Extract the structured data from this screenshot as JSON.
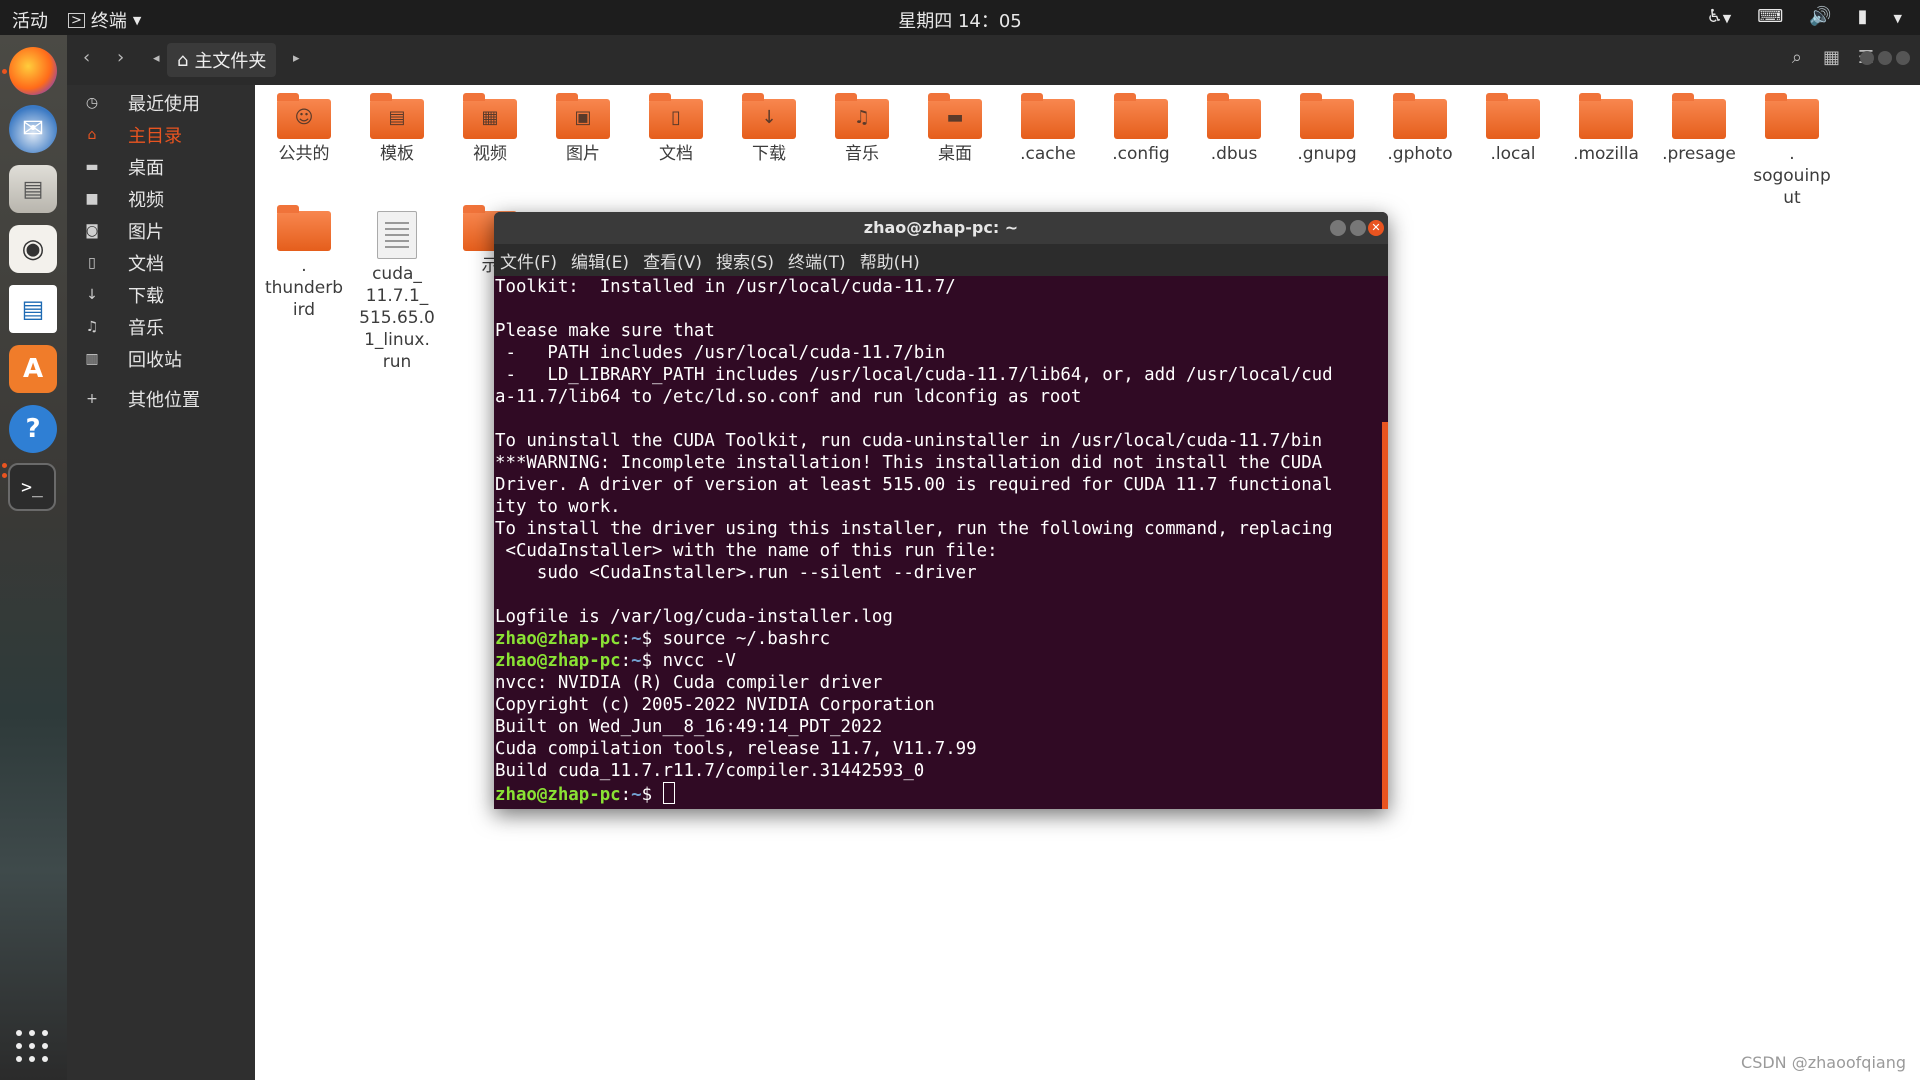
{
  "topbar": {
    "activities": "活动",
    "app_name": "终端",
    "clock": "星期四 14：05",
    "tray_icons": [
      "accessibility-icon",
      "keyboard-icon",
      "volume-icon",
      "battery-icon",
      "power-menu-icon"
    ]
  },
  "dock": {
    "items": [
      "firefox-icon",
      "thunderbird-icon",
      "files-icon",
      "rhythmbox-icon",
      "writer-icon",
      "software-icon",
      "help-icon",
      "terminal-icon"
    ],
    "show_apps": "show-applications-icon"
  },
  "file_manager": {
    "path_label": "主文件夹",
    "sidebar": [
      {
        "label": "最近使用",
        "icon": "clock-icon"
      },
      {
        "label": "主目录",
        "icon": "home-icon"
      },
      {
        "label": "桌面",
        "icon": "desktop-icon"
      },
      {
        "label": "视频",
        "icon": "video-icon"
      },
      {
        "label": "图片",
        "icon": "camera-icon"
      },
      {
        "label": "文档",
        "icon": "document-icon"
      },
      {
        "label": "下载",
        "icon": "download-icon"
      },
      {
        "label": "音乐",
        "icon": "music-icon"
      },
      {
        "label": "回收站",
        "icon": "trash-icon"
      },
      {
        "label": "其他位置",
        "icon": "plus-icon"
      }
    ],
    "files": [
      {
        "label": "公共的",
        "emblem": "user-emblem"
      },
      {
        "label": "模板",
        "emblem": "template-emblem"
      },
      {
        "label": "视频",
        "emblem": "film-emblem"
      },
      {
        "label": "图片",
        "emblem": "picture-emblem"
      },
      {
        "label": "文档",
        "emblem": "document-emblem"
      },
      {
        "label": "下载",
        "emblem": "download-emblem"
      },
      {
        "label": "音乐",
        "emblem": "music-emblem"
      },
      {
        "label": "桌面",
        "emblem": "desktop-emblem"
      },
      {
        "label": ".cache",
        "emblem": ""
      },
      {
        "label": ".config",
        "emblem": ""
      },
      {
        "label": ".dbus",
        "emblem": ""
      },
      {
        "label": ".gnupg",
        "emblem": ""
      },
      {
        "label": ".gphoto",
        "emblem": ""
      },
      {
        "label": ".local",
        "emblem": ""
      },
      {
        "label": ".mozilla",
        "emblem": ""
      },
      {
        "label": ".presage",
        "emblem": ""
      },
      {
        "label": ".\nsogouinp\nut",
        "emblem": ""
      },
      {
        "label": ".\nthunderb\nird",
        "emblem": ""
      },
      {
        "label": "cuda_\n11.7.1_\n515.65.0\n1_linux.\nrun",
        "emblem": "file"
      },
      {
        "label": "示",
        "emblem": ""
      }
    ]
  },
  "terminal": {
    "title": "zhao@zhap-pc: ~",
    "menu": [
      "文件(F)",
      "编辑(E)",
      "查看(V)",
      "搜索(S)",
      "终端(T)",
      "帮助(H)"
    ],
    "prompt_user": "zhao@zhap-pc",
    "prompt_path": "~",
    "lines": [
      "Toolkit:  Installed in /usr/local/cuda-11.7/",
      "",
      "Please make sure that",
      " -   PATH includes /usr/local/cuda-11.7/bin",
      " -   LD_LIBRARY_PATH includes /usr/local/cuda-11.7/lib64, or, add /usr/local/cud",
      "a-11.7/lib64 to /etc/ld.so.conf and run ldconfig as root",
      "",
      "To uninstall the CUDA Toolkit, run cuda-uninstaller in /usr/local/cuda-11.7/bin",
      "***WARNING: Incomplete installation! This installation did not install the CUDA",
      "Driver. A driver of version at least 515.00 is required for CUDA 11.7 functional",
      "ity to work.",
      "To install the driver using this installer, run the following command, replacing",
      " <CudaInstaller> with the name of this run file:",
      "    sudo <CudaInstaller>.run --silent --driver",
      "",
      "Logfile is /var/log/cuda-installer.log",
      {
        "cmd": "source ~/.bashrc"
      },
      {
        "cmd": "nvcc -V"
      },
      "nvcc: NVIDIA (R) Cuda compiler driver",
      "Copyright (c) 2005-2022 NVIDIA Corporation",
      "Built on Wed_Jun__8_16:49:14_PDT_2022",
      "Cuda compilation tools, release 11.7, V11.7.99",
      "Build cuda_11.7.r11.7/compiler.31442593_0",
      {
        "cmd": ""
      }
    ]
  },
  "watermark": "CSDN @zhaoofqiang",
  "colors": {
    "accent": "#e95420",
    "terminal_bg": "#300a24",
    "prompt_user": "#8ae234",
    "prompt_path": "#729fcf"
  }
}
